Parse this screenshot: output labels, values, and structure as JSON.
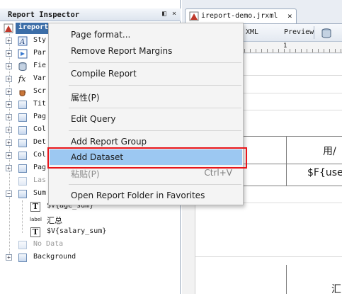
{
  "inspector": {
    "title": "Report Inspector",
    "minimize_glyph": "◧",
    "close_glyph": "×",
    "root": "ireport",
    "items": [
      {
        "label": "Sty",
        "icon": "styles-icon",
        "expander": "+"
      },
      {
        "label": "Par",
        "icon": "parameters-icon",
        "expander": "+"
      },
      {
        "label": "Fie",
        "icon": "fields-icon",
        "expander": "+"
      },
      {
        "label": "Var",
        "icon": "variables-icon",
        "expander": "+"
      },
      {
        "label": "Scr",
        "icon": "scriptlets-icon",
        "expander": "+"
      },
      {
        "label": "Tit",
        "icon": "band-icon",
        "expander": "+"
      },
      {
        "label": "Pag",
        "icon": "band-icon",
        "expander": "+"
      },
      {
        "label": "Col",
        "icon": "band-icon",
        "expander": "+"
      },
      {
        "label": "Det",
        "icon": "band-icon",
        "expander": "+"
      },
      {
        "label": "Col",
        "icon": "band-icon",
        "expander": "+"
      },
      {
        "label": "Pag",
        "icon": "band-icon",
        "expander": "+"
      },
      {
        "label": "Las",
        "icon": "band-icon",
        "expander": "",
        "dim": true
      },
      {
        "label": "Sum",
        "icon": "band-icon",
        "expander": "−"
      }
    ],
    "summary_children": [
      {
        "label": "$V{age_sum}",
        "icon": "textfield-icon"
      },
      {
        "label": "汇总",
        "icon": "label-icon",
        "icon_text": "label"
      },
      {
        "label": "$V{salary_sum}",
        "icon": "textfield-icon"
      }
    ],
    "after": [
      {
        "label": "No Data",
        "dim": true
      },
      {
        "label": "Background",
        "expander": "+"
      }
    ]
  },
  "editor": {
    "tab_label": "ireport-demo.jrxml",
    "tab_close": "×",
    "toolbar": {
      "xml": "XML",
      "preview": "Preview"
    },
    "ruler_mark": "1",
    "cells": [
      "用/",
      "$F{use",
      "汇"
    ]
  },
  "context_menu": {
    "items": [
      {
        "label": "Page format...",
        "shortcut": ""
      },
      {
        "label": "Remove Report Margins",
        "shortcut": ""
      },
      {
        "label": "Compile Report",
        "shortcut": ""
      },
      {
        "label": "属性(P)",
        "shortcut": ""
      },
      {
        "label": "Edit Query",
        "shortcut": ""
      },
      {
        "label": "Add Report Group",
        "shortcut": ""
      },
      {
        "label": "Add Dataset",
        "shortcut": "",
        "highlighted": true
      },
      {
        "label": "粘贴(P)",
        "shortcut": "Ctrl+V",
        "disabled": true
      },
      {
        "label": "Open Report Folder in Favorites",
        "shortcut": ""
      }
    ]
  },
  "colors": {
    "highlight": "#9cc8f2",
    "annotation_box": "#e8161b",
    "selection": "#3c6ea8"
  }
}
